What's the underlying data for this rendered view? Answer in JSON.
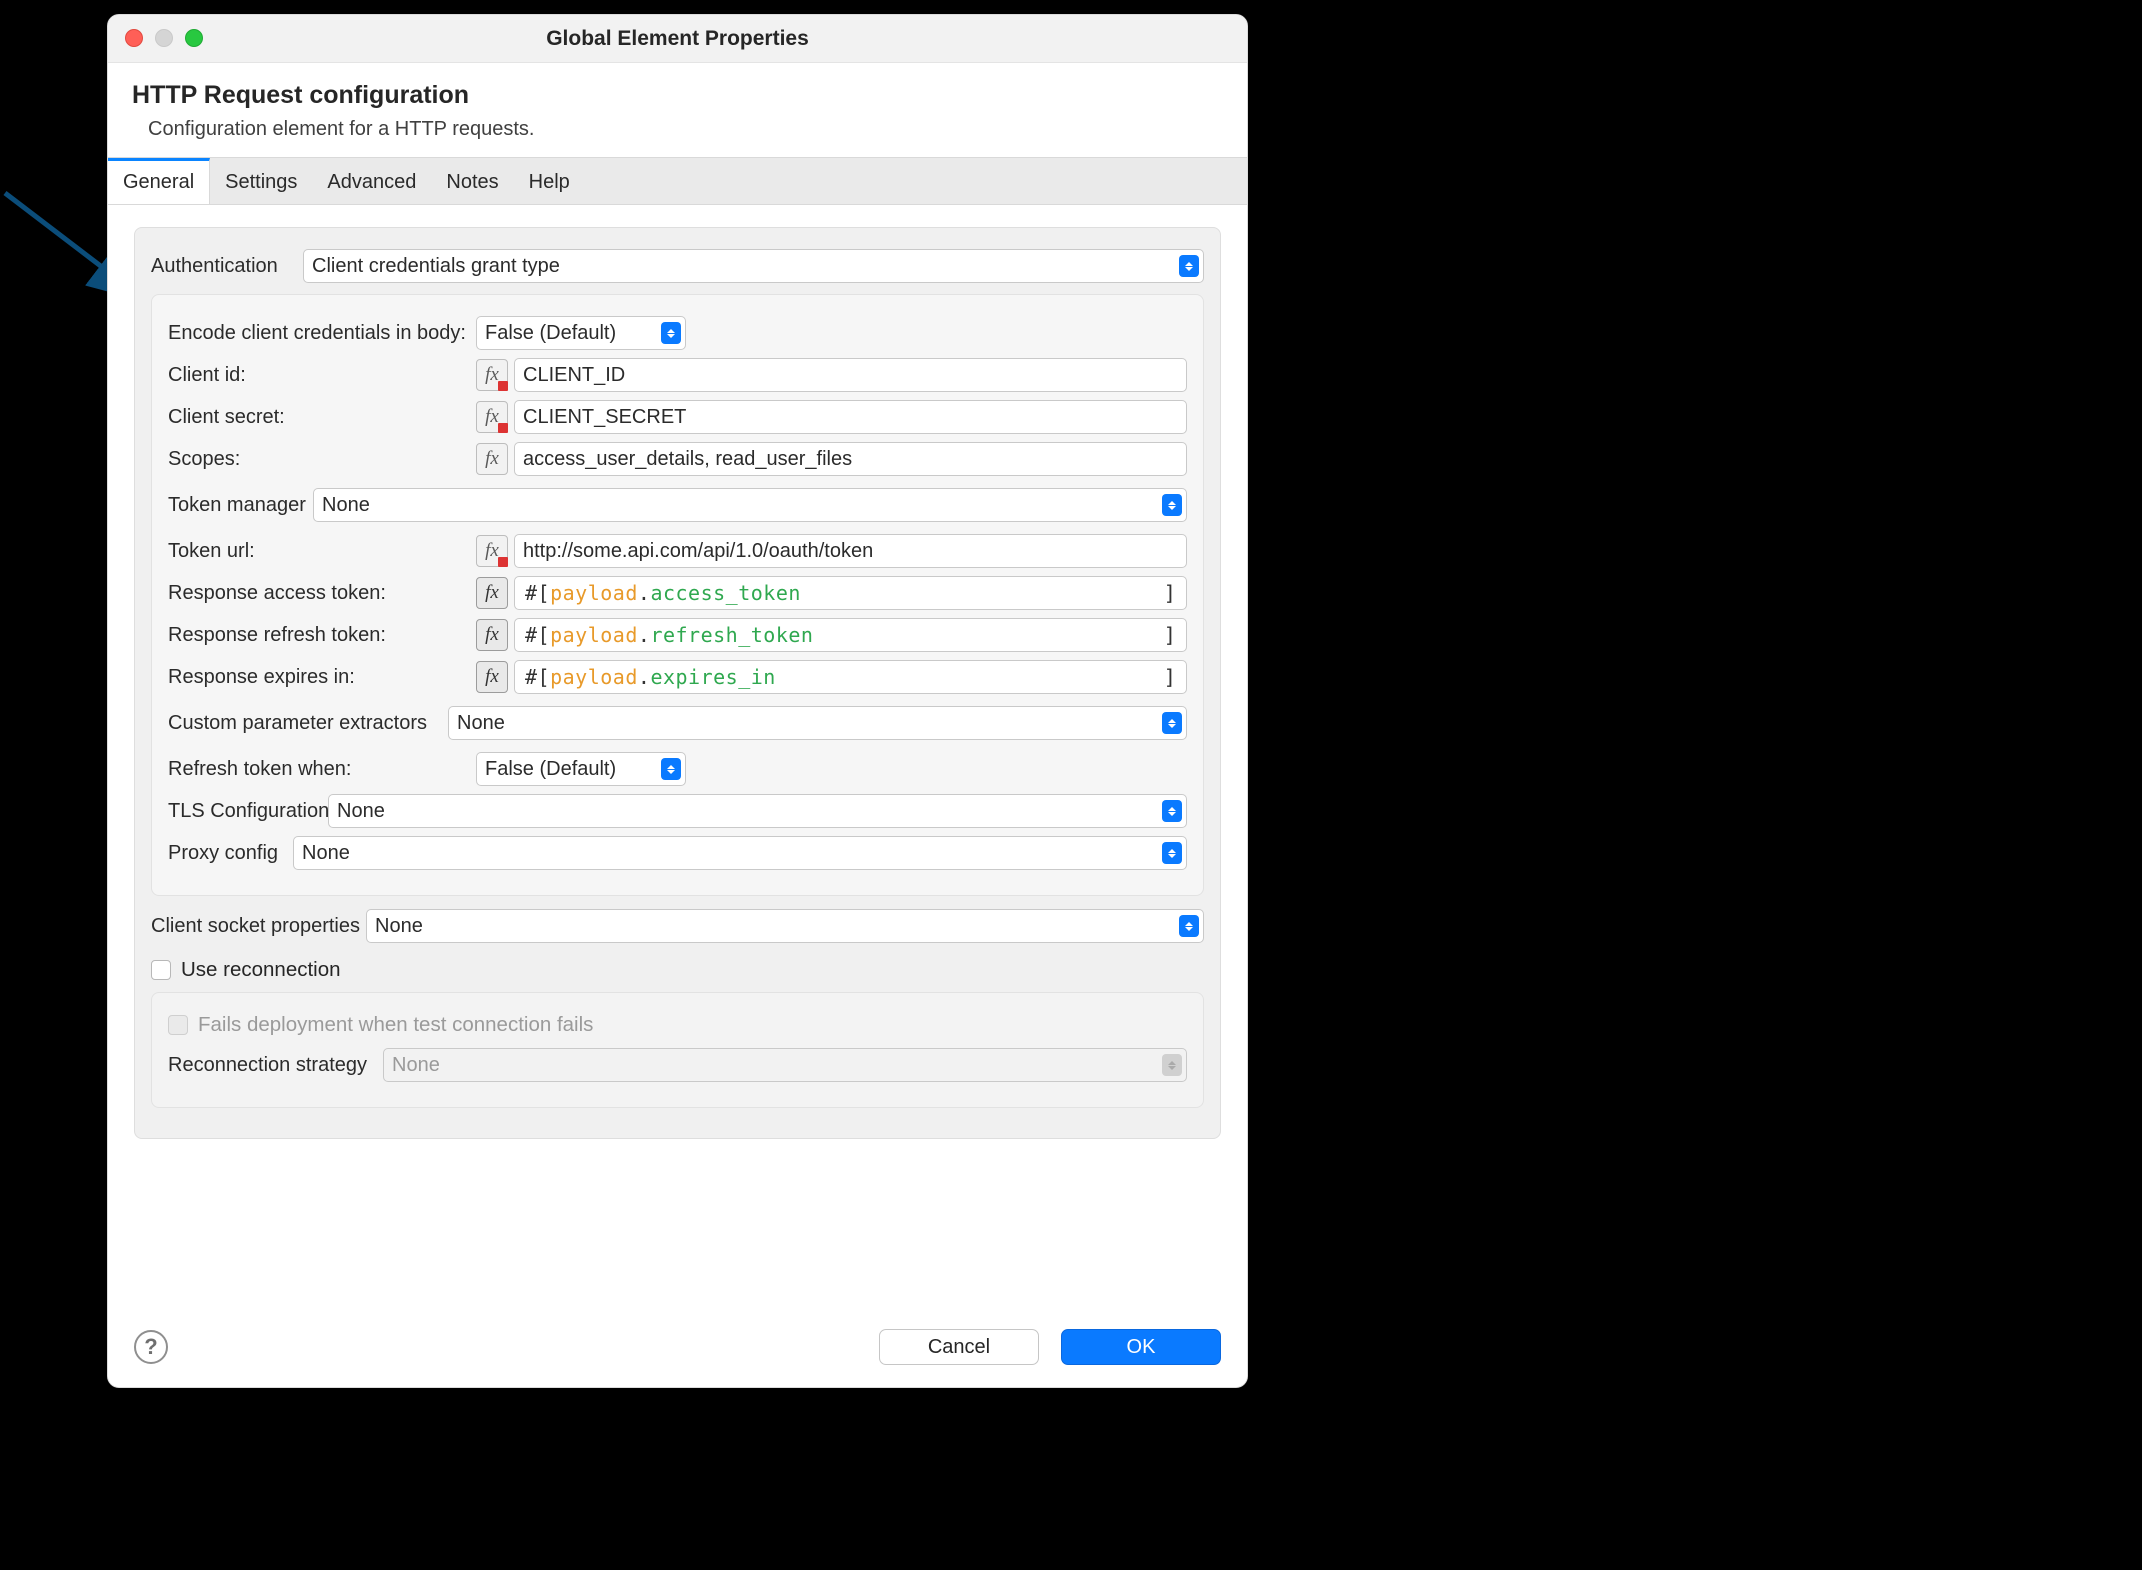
{
  "window": {
    "title": "Global Element Properties"
  },
  "header": {
    "title": "HTTP Request configuration",
    "subtitle": "Configuration element for a HTTP requests."
  },
  "tabs": [
    "General",
    "Settings",
    "Advanced",
    "Notes",
    "Help"
  ],
  "active_tab": 0,
  "labels": {
    "authentication": "Authentication",
    "encode": "Encode client credentials in body:",
    "client_id": "Client id:",
    "client_secret": "Client secret:",
    "scopes": "Scopes:",
    "token_manager": "Token manager",
    "token_url": "Token url:",
    "resp_access": "Response access token:",
    "resp_refresh": "Response refresh token:",
    "resp_expires": "Response expires in:",
    "cpe": "Custom parameter extractors",
    "refresh_when": "Refresh token when:",
    "tls": "TLS Configuration",
    "proxy": "Proxy config",
    "csp": "Client socket properties",
    "use_reconnection": "Use reconnection",
    "fails_deploy": "Fails deployment when test connection fails",
    "reconnection_strategy": "Reconnection strategy"
  },
  "values": {
    "authentication": "Client credentials grant type",
    "encode": "False (Default)",
    "client_id": "CLIENT_ID",
    "client_secret": "CLIENT_SECRET",
    "scopes": "access_user_details, read_user_files",
    "token_manager": "None",
    "token_url": "http://some.api.com/api/1.0/oauth/token",
    "cpe": "None",
    "refresh_when": "False (Default)",
    "tls": "None",
    "proxy": "None",
    "csp": "None",
    "reconnection_strategy": "None"
  },
  "expressions": {
    "access": {
      "open": "#[ ",
      "obj": "payload",
      "dot": ".",
      "prop": "access_token",
      "close": "]"
    },
    "refresh": {
      "open": "#[ ",
      "obj": "payload",
      "dot": ".",
      "prop": "refresh_token",
      "close": "]"
    },
    "expires": {
      "open": "#[ ",
      "obj": "payload",
      "dot": ".",
      "prop": "expires_in",
      "close": "]"
    }
  },
  "fx_glyph": "fx",
  "buttons": {
    "cancel": "Cancel",
    "ok": "OK",
    "help": "?"
  }
}
